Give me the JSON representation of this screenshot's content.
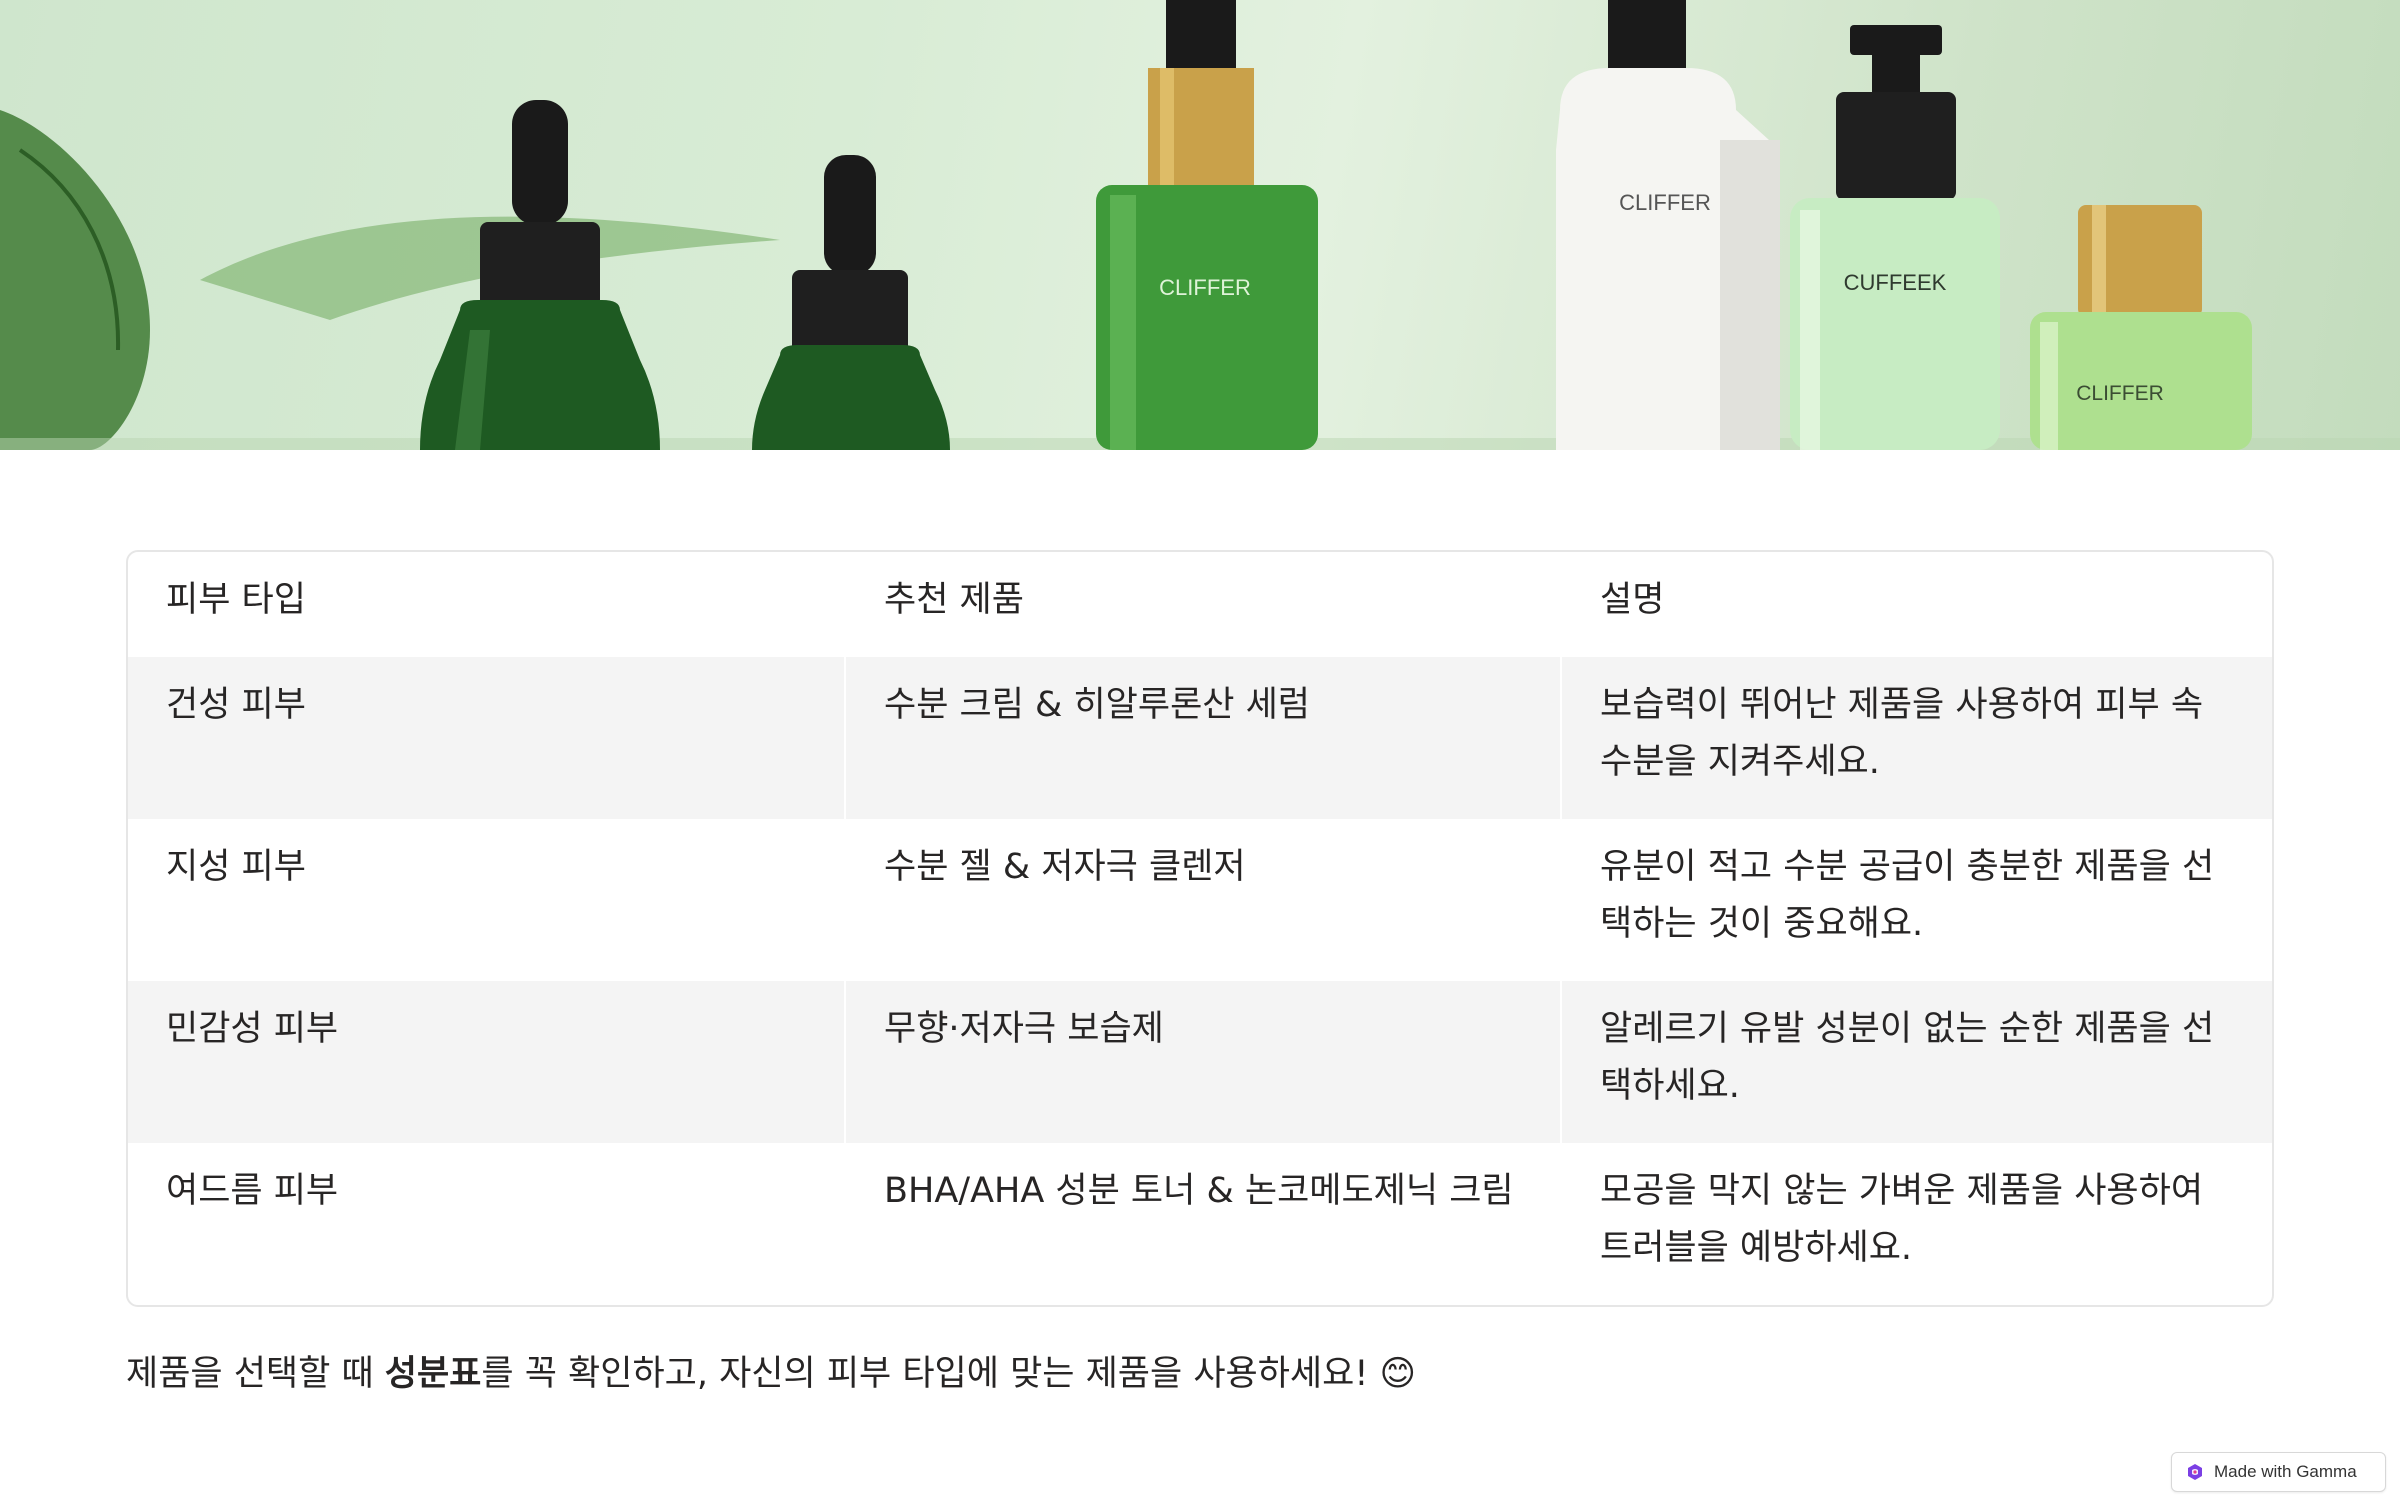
{
  "hero": {
    "image_subject": "green skincare bottles on pale green background",
    "bottle_labels": [
      "CLIFFER",
      "CLIFFER",
      "CUFFEEK",
      "CLIFFER"
    ]
  },
  "table": {
    "headers": [
      "피부 타입",
      "추천 제품",
      "설명"
    ],
    "rows": [
      {
        "skin_type": "건성 피부",
        "product": "수분 크림 & 히알루론산 세럼",
        "description_line1": "보습력이 뛰어난 제품을 사용하여 피부 속",
        "description_line2": "수분을 지켜주세요."
      },
      {
        "skin_type": "지성 피부",
        "product": "수분 젤 & 저자극 클렌저",
        "description_line1": "유분이 적고 수분 공급이 충분한 제품을 선",
        "description_line2": "택하는 것이 중요해요."
      },
      {
        "skin_type": "민감성 피부",
        "product": "무향·저자극 보습제",
        "description_line1": "알레르기 유발 성분이 없는 순한 제품을 선",
        "description_line2": "택하세요."
      },
      {
        "skin_type": "여드름 피부",
        "product": "BHA/AHA 성분 토너 & 논코메도제닉 크림",
        "description_line1": "모공을 막지 않는 가벼운 제품을 사용하여",
        "description_line2": "트러블을 예방하세요."
      }
    ]
  },
  "footnote": {
    "before": "제품을 선택할 때 ",
    "bold": "성분표",
    "after": "를 꼭 확인하고, 자신의 피부 타입에 맞는 제품을 사용하세요! 😊"
  },
  "badge": {
    "label": "Made with Gamma",
    "icon": "gamma-logo-icon"
  },
  "colors": {
    "text": "#272525",
    "stripe": "#f4f4f4",
    "border": "#e6e6e6",
    "hero_bg": "#d8ecd5",
    "bottle_dark_green": "#1e5a22",
    "bottle_green": "#3f9a3a",
    "bottle_light_green": "#c7ecc3",
    "badge_logo": "#7b3fe4"
  }
}
